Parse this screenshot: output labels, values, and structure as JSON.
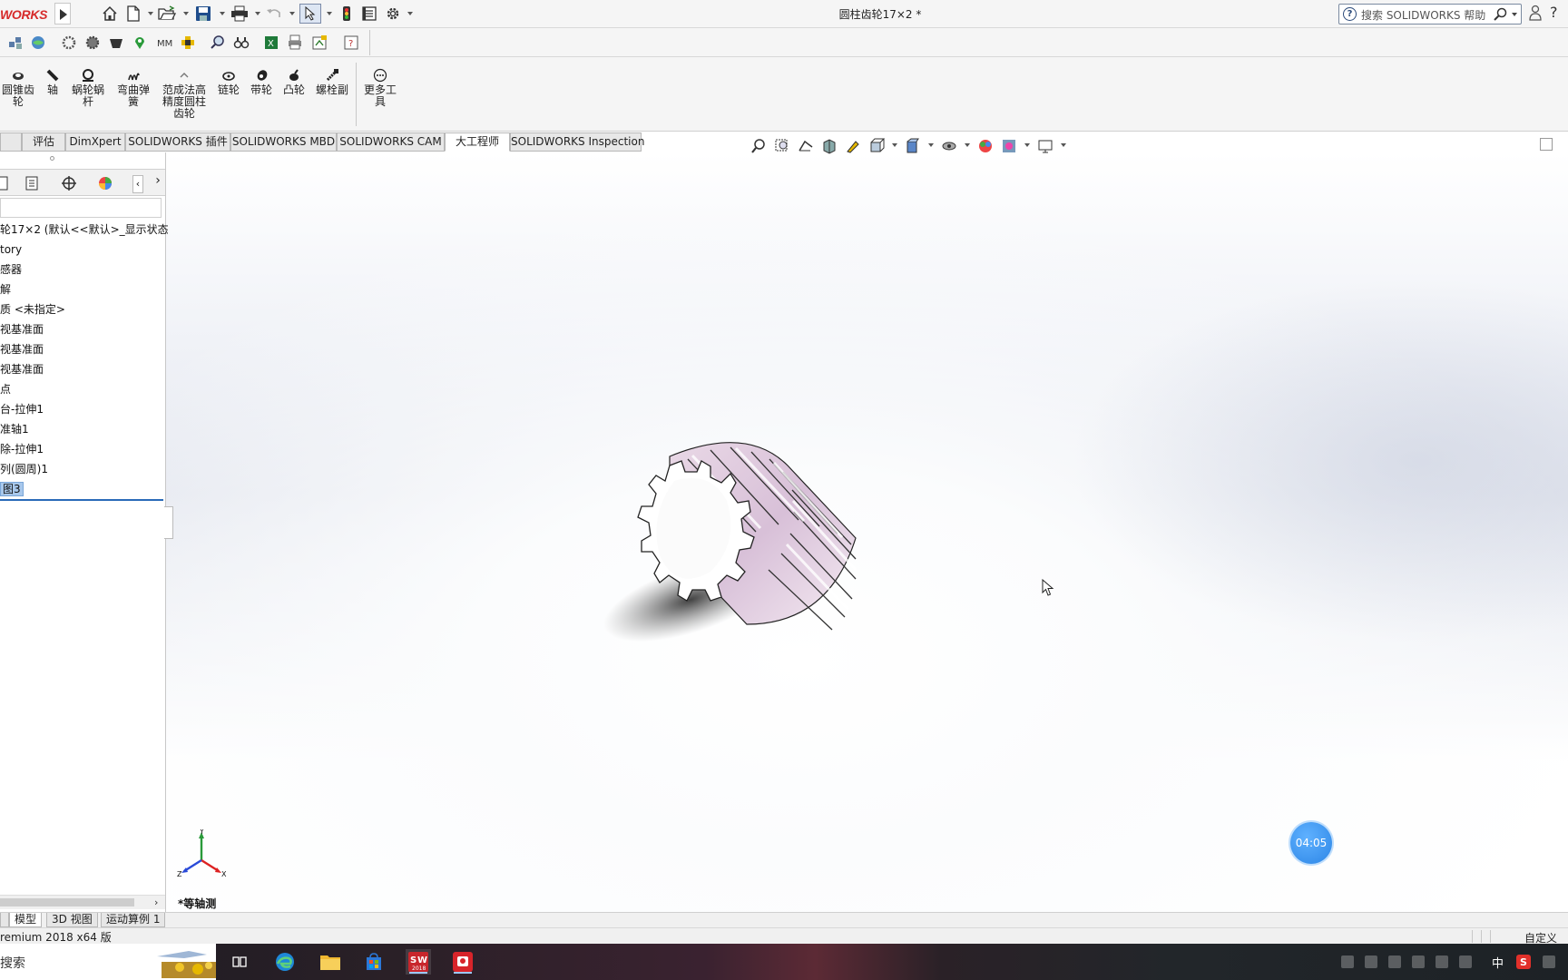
{
  "app": {
    "logo_text": "WORKS",
    "document_title": "圆柱齿轮17×2 *",
    "help_search_placeholder": "搜索 SOLIDWORKS 帮助",
    "help_question": "?"
  },
  "ribbon": {
    "tools": [
      {
        "label": "圆锥齿\n轮",
        "icon": "bevel-gear-icon"
      },
      {
        "label": "轴",
        "icon": "shaft-icon"
      },
      {
        "label": "蜗轮蜗\n杆",
        "icon": "worm-gear-icon"
      },
      {
        "label": "弯曲弹\n簧",
        "icon": "spring-icon"
      },
      {
        "label": "范成法高\n精度圆柱\n齿轮",
        "icon": "spur-gear-icon"
      },
      {
        "label": "链轮",
        "icon": "sprocket-icon"
      },
      {
        "label": "带轮",
        "icon": "pulley-icon"
      },
      {
        "label": "凸轮",
        "icon": "cam-icon"
      },
      {
        "label": "螺栓副",
        "icon": "bolt-icon"
      },
      {
        "label": "更多工\n具",
        "icon": "more-tools-icon"
      }
    ]
  },
  "command_tabs": [
    {
      "label": "评估",
      "active": false
    },
    {
      "label": "DimXpert",
      "active": false
    },
    {
      "label": "SOLIDWORKS 插件",
      "active": false
    },
    {
      "label": "SOLIDWORKS MBD",
      "active": false
    },
    {
      "label": "SOLIDWORKS CAM",
      "active": false
    },
    {
      "label": "大工程师",
      "active": true
    },
    {
      "label": "SOLIDWORKS Inspection",
      "active": false
    }
  ],
  "feature_tree": {
    "items": [
      {
        "label": "轮17×2  (默认<<默认>_显示状态"
      },
      {
        "label": "tory"
      },
      {
        "label": "感器"
      },
      {
        "label": "解"
      },
      {
        "label": "质 <未指定>"
      },
      {
        "label": "视基准面"
      },
      {
        "label": "视基准面"
      },
      {
        "label": "视基准面"
      },
      {
        "label": "点"
      },
      {
        "label": "台-拉伸1"
      },
      {
        "label": "准轴1"
      },
      {
        "label": "除-拉伸1"
      },
      {
        "label": "列(圆周)1"
      },
      {
        "label": "图3"
      }
    ],
    "selected_index": 13
  },
  "graphics": {
    "view_label": "*等轴测",
    "timer": "04:05",
    "triad_labels": {
      "x": "X",
      "y": "Y",
      "z": "Z"
    }
  },
  "model_tabs": [
    {
      "label": "模型",
      "active": true
    },
    {
      "label": "3D 视图",
      "active": false
    },
    {
      "label": "运动算例 1",
      "active": false
    }
  ],
  "status": {
    "left": "remium 2018 x64 版",
    "right": "自定义"
  },
  "taskbar": {
    "search_text": "搜索",
    "ime": "中",
    "apps": [
      "task-view-icon",
      "edge-icon",
      "file-explorer-icon",
      "store-icon",
      "solidworks-icon",
      "red-app-icon"
    ]
  }
}
